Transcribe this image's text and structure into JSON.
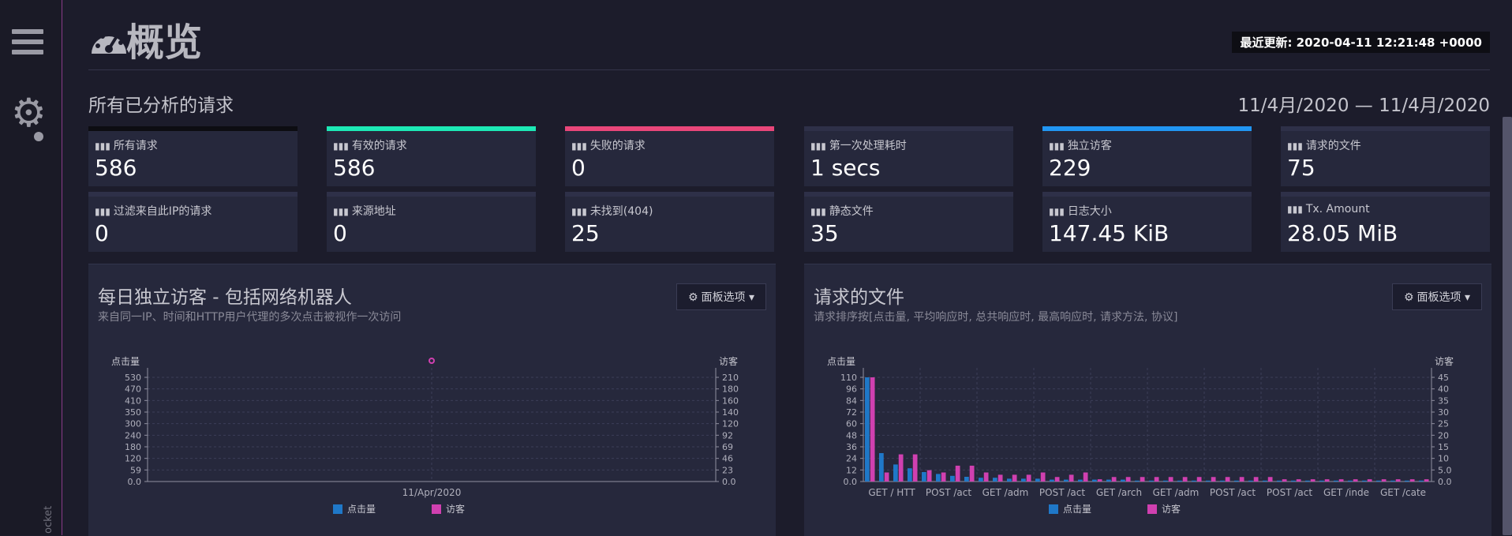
{
  "sidebar": {
    "vertical_label": "ocket"
  },
  "header": {
    "title": "概览",
    "updated": "最近更新: 2020-04-11 12:21:48 +0000"
  },
  "overall": {
    "heading": "所有已分析的请求",
    "date_range": "11/4月/2020 — 11/4月/2020"
  },
  "stats": [
    {
      "label": "所有请求",
      "value": "586",
      "color": "#0d0d12"
    },
    {
      "label": "有效的请求",
      "value": "586",
      "color": "#1de9b6"
    },
    {
      "label": "失败的请求",
      "value": "0",
      "color": "#e9467a"
    },
    {
      "label": "第一次处理耗时",
      "value": "1 secs",
      "color": "#2e3048"
    },
    {
      "label": "独立访客",
      "value": "229",
      "color": "#2196f3"
    },
    {
      "label": "请求的文件",
      "value": "75",
      "color": "#2e3048"
    },
    {
      "label": "过滤来自此IP的请求",
      "value": "0",
      "color": "#2e3048"
    },
    {
      "label": "来源地址",
      "value": "0",
      "color": "#2e3048"
    },
    {
      "label": "未找到(404)",
      "value": "25",
      "color": "#2e3048"
    },
    {
      "label": "静态文件",
      "value": "35",
      "color": "#2e3048"
    },
    {
      "label": "日志大小",
      "value": "147.45 KiB",
      "color": "#2e3048"
    },
    {
      "label": "Tx. Amount",
      "value": "28.05 MiB",
      "color": "#2e3048"
    }
  ],
  "panels": {
    "visitors": {
      "title": "每日独立访客 - 包括网络机器人",
      "subtitle": "来自同一IP、时间和HTTP用户代理的多次点击被视作一次访问",
      "button": "面板选项"
    },
    "requests": {
      "title": "请求的文件",
      "subtitle": "请求排序按[点击量, 平均响应时, 总共响应时, 最高响应时, 请求方法, 协议]",
      "button": "面板选项"
    }
  },
  "colors": {
    "hits": "#1f78c8",
    "visitors": "#d040b0",
    "accent_bg": "#26283c"
  },
  "icons": [
    "menu-icon",
    "gear-icon",
    "dashboard-icon",
    "bar-chart-icon",
    "cog-icon",
    "caret-down-icon"
  ],
  "chart_data": [
    {
      "type": "scatter",
      "title": "",
      "x_label": "",
      "y_label_left": "点击量",
      "y_label_right": "访客",
      "categories": [
        "11/Apr/2020"
      ],
      "ylim_left": [
        0,
        586
      ],
      "ylim_right": [
        0,
        229
      ],
      "yticks_left": [
        "0.0",
        "59",
        "120",
        "180",
        "240",
        "300",
        "350",
        "410",
        "470",
        "530"
      ],
      "yticks_right": [
        "0.0",
        "23",
        "46",
        "69",
        "92",
        "120",
        "140",
        "160",
        "180",
        "210"
      ],
      "series": [
        {
          "name": "点击量",
          "values": [
            586
          ]
        },
        {
          "name": "访客",
          "values": [
            229
          ]
        }
      ],
      "legend_position": "bottom",
      "grid": true
    },
    {
      "type": "bar",
      "title": "",
      "x_label": "",
      "y_label_left": "点击量",
      "y_label_right": "访客",
      "ylim_left": [
        0,
        110
      ],
      "ylim_right": [
        0,
        46
      ],
      "yticks_left": [
        "0.0",
        "12",
        "24",
        "36",
        "48",
        "60",
        "72",
        "84",
        "96",
        "110"
      ],
      "yticks_right": [
        "0.0",
        "5.0",
        "10",
        "15",
        "20",
        "25",
        "30",
        "35",
        "40",
        "45"
      ],
      "tick_labels": [
        "GET / HTT",
        "POST /act",
        "GET /adm",
        "POST /act",
        "GET /arch",
        "GET /adm",
        "POST /act",
        "POST /act",
        "GET /inde",
        "GET /cate"
      ],
      "series": [
        {
          "name": "点击量",
          "values": [
            110,
            30,
            18,
            14,
            10,
            8,
            6,
            5,
            4,
            4,
            3,
            3,
            3,
            2,
            2,
            2,
            2,
            2,
            2,
            1,
            1,
            1,
            1,
            1,
            1,
            1,
            1,
            1,
            1,
            1,
            1,
            1,
            1,
            1,
            1,
            1,
            1,
            1,
            1,
            1
          ]
        },
        {
          "name": "访客",
          "values": [
            46,
            4,
            12,
            12,
            5,
            4,
            7,
            7,
            4,
            3,
            3,
            3,
            4,
            2,
            3,
            4,
            1,
            2,
            2,
            2,
            2,
            2,
            2,
            2,
            2,
            2,
            2,
            2,
            2,
            1,
            1,
            1,
            1,
            1,
            1,
            1,
            1,
            1,
            1,
            1
          ]
        }
      ],
      "legend_position": "bottom",
      "grid": true
    }
  ]
}
